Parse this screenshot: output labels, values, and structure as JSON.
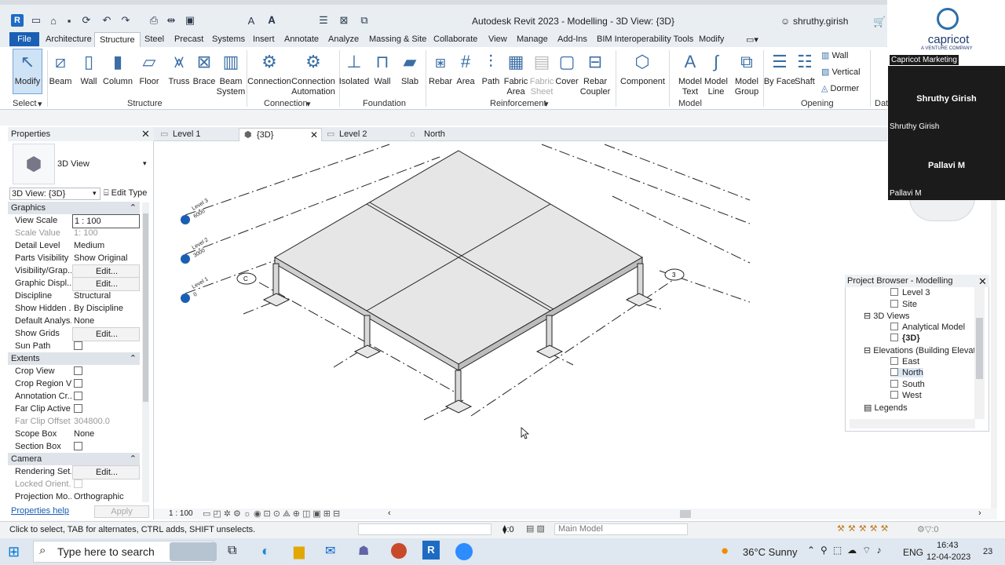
{
  "window": {
    "title": "Autodesk Revit 2023 - Modelling - 3D View: {3D}",
    "user": "shruthy.girish"
  },
  "menu": {
    "file": "File",
    "tabs": [
      "Architecture",
      "Structure",
      "Steel",
      "Precast",
      "Systems",
      "Insert",
      "Annotate",
      "Analyze",
      "Massing & Site",
      "Collaborate",
      "View",
      "Manage",
      "Add-Ins",
      "BIM Interoperability Tools",
      "Modify"
    ],
    "active": "Structure"
  },
  "ribbon": {
    "modify": "Modify",
    "select": "Select",
    "structure": [
      "Beam",
      "Wall",
      "Column",
      "Floor",
      "Truss",
      "Brace",
      "Beam System"
    ],
    "structure_panel": "Structure",
    "connection": [
      "Connection",
      "Connection Automation"
    ],
    "connection_panel": "Connection",
    "foundation": [
      "Isolated",
      "Wall",
      "Slab"
    ],
    "foundation_panel": "Foundation",
    "reinforcement": [
      "Rebar",
      "Area",
      "Path",
      "Fabric Area",
      "Fabric Sheet",
      "Cover",
      "Rebar Coupler"
    ],
    "reinforcement_panel": "Reinforcement",
    "component": "Component",
    "model": [
      "Model Text",
      "Model Line",
      "Model Group"
    ],
    "model_panel": "Model",
    "opening": [
      "By Face",
      "Shaft"
    ],
    "opening_small": [
      "Wall",
      "Vertical",
      "Dormer"
    ],
    "opening_panel": "Opening",
    "datum_panel": "Dat"
  },
  "properties": {
    "title": "Properties",
    "type_name": "3D View",
    "selector": "3D View: {3D}",
    "edit_type": "Edit Type",
    "sections": {
      "graphics": "Graphics",
      "extents": "Extents",
      "camera": "Camera"
    },
    "graphics": [
      {
        "k": "View Scale",
        "v": "1 : 100"
      },
      {
        "k": "Scale Value",
        "v": "1:  100"
      },
      {
        "k": "Detail Level",
        "v": "Medium"
      },
      {
        "k": "Parts Visibility",
        "v": "Show Original"
      },
      {
        "k": "Visibility/Grap...",
        "v": "Edit..."
      },
      {
        "k": "Graphic Displ...",
        "v": "Edit..."
      },
      {
        "k": "Discipline",
        "v": "Structural"
      },
      {
        "k": "Show Hidden ...",
        "v": "By Discipline"
      },
      {
        "k": "Default Analys...",
        "v": "None"
      },
      {
        "k": "Show Grids",
        "v": "Edit..."
      },
      {
        "k": "Sun Path",
        "v": ""
      }
    ],
    "extents": [
      {
        "k": "Crop View",
        "v": ""
      },
      {
        "k": "Crop Region V...",
        "v": ""
      },
      {
        "k": "Annotation Cr...",
        "v": ""
      },
      {
        "k": "Far Clip Active",
        "v": ""
      },
      {
        "k": "Far Clip Offset",
        "v": "304800.0"
      },
      {
        "k": "Scope Box",
        "v": "None"
      },
      {
        "k": "Section Box",
        "v": ""
      }
    ],
    "camera": [
      {
        "k": "Rendering Set...",
        "v": "Edit..."
      },
      {
        "k": "Locked Orient...",
        "v": ""
      },
      {
        "k": "Projection Mo...",
        "v": "Orthographic"
      }
    ],
    "help": "Properties help",
    "apply": "Apply"
  },
  "view_tabs": [
    "Level 1",
    "{3D}",
    "Level 2",
    "North"
  ],
  "model": {
    "levels": [
      {
        "name": "Level 3",
        "elev": "6000"
      },
      {
        "name": "Level 2",
        "elev": "3000"
      },
      {
        "name": "Level 1",
        "elev": "0"
      }
    ],
    "grid_c": "C",
    "grid_3": "3"
  },
  "project_browser": {
    "title": "Project Browser - Modelling",
    "items": [
      "Level 3",
      "Site",
      "3D Views",
      "Analytical Model",
      "{3D}",
      "Elevations (Building Elevati",
      "East",
      "North",
      "South",
      "West",
      "Legends"
    ]
  },
  "view_control": {
    "scale": "1 : 100"
  },
  "status": {
    "hint": "Click to select, TAB for alternates, CTRL adds, SHIFT unselects.",
    "zero": ":0",
    "model": "Main Model",
    "right_zero": ":0"
  },
  "taskbar": {
    "search": "Type here to search",
    "weather": "36°C  Sunny",
    "lang": "ENG",
    "time": "16:43",
    "date": "12-04-2023",
    "badge": "23"
  },
  "zoom": {
    "company": "capricot",
    "company_sub": "A VENTURE COMPANY",
    "p1": "Capricot Marketing",
    "p2": "Shruthy Girish",
    "p2_label": "Shruthy Girish",
    "p3": "Pallavi M",
    "p3_label": "Pallavi M"
  }
}
